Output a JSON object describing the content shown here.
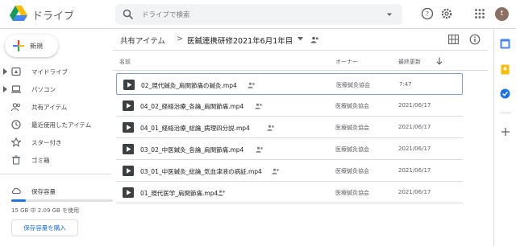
{
  "header": {
    "app_name": "ドライブ",
    "search_placeholder": "ドライブで検索",
    "avatar_letter": "t"
  },
  "sidebar": {
    "new_label": "新規",
    "items": [
      {
        "label": "マイドライブ",
        "icon": "my-drive-icon",
        "has_arrow": true
      },
      {
        "label": "パソコン",
        "icon": "computer-icon",
        "has_arrow": true
      },
      {
        "label": "共有アイテム",
        "icon": "shared-people-icon",
        "has_arrow": false
      },
      {
        "label": "最近使用したアイテム",
        "icon": "clock-icon",
        "has_arrow": false
      },
      {
        "label": "スター付き",
        "icon": "star-icon",
        "has_arrow": false
      },
      {
        "label": "ゴミ箱",
        "icon": "trash-icon",
        "has_arrow": false
      }
    ],
    "storage_label": "保存容量",
    "storage_text": "15 GB 中 2.09 GB を使用",
    "storage_fraction": 0.14,
    "buy_label": "保存容量を購入"
  },
  "breadcrumb": {
    "parent": "共有アイテム",
    "separator": ">",
    "current": "医鍼連携研修2021年6月1年目"
  },
  "columns": {
    "name": "名前",
    "owner": "オーナー",
    "modified": "最終更新"
  },
  "files": [
    {
      "name": "02_現代鍼灸_肩関節痛の鍼灸.mp4",
      "owner": "医療鍼灸協会",
      "modified": "7:47",
      "selected": true
    },
    {
      "name": "04_02_経絡治療_各論_肩関節痛.mp4",
      "owner": "医療鍼灸協会",
      "modified": "2021/06/17",
      "selected": false
    },
    {
      "name": "04_01_経絡治療_総論_病理四分説.mp4",
      "owner": "医療鍼灸協会",
      "modified": "2021/06/17",
      "selected": false
    },
    {
      "name": "03_02_中医鍼灸_各論_肩関節痛.mp4",
      "owner": "医療鍼灸協会",
      "modified": "2021/06/17",
      "selected": false
    },
    {
      "name": "03_01_中医鍼灸_総論_気血津液の病証.mp4",
      "owner": "医療鍼灸協会",
      "modified": "2021/06/17",
      "selected": false
    },
    {
      "name": "01_現代医学_肩関節痛.mp4",
      "owner": "医療鍼灸協会",
      "modified": "2021/06/17",
      "selected": false
    }
  ],
  "colors": {
    "accent": "#1a73e8",
    "selected_border": "#7ba0e8",
    "divider": "#dadce0"
  }
}
